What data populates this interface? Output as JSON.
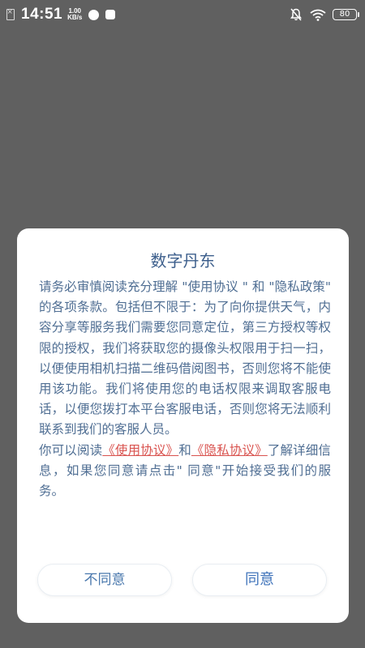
{
  "status_bar": {
    "time": "14:51",
    "net_speed_value": "1.00",
    "net_speed_unit": "KB/s",
    "battery": "80"
  },
  "dialog": {
    "title": "数字丹东",
    "paragraph1": "请务必审慎阅读充分理解 \"使用协议 \" 和 \"隐私政策\" 的各项条款。包括但不限于：为了向你提供天气，内容分享等服务我们需要您同意定位，第三方授权等权限的授权，我们将获取您的摄像头权限用于扫一扫，以便使用相机扫描二维码借阅图书，否则您将不能使用该功能。我们将使用您的电话权限来调取客服电话，以便您拨打本平台客服电话，否则您将无法顺利联系到我们的客服人员。",
    "p2_prefix": "你可以阅读",
    "link_terms": "《使用协议》",
    "p2_and": "和",
    "link_privacy": "《隐私协议》",
    "p2_suffix": "了解详细信息，如果您同意请点击\" 同意\"开始接受我们的服务。",
    "disagree_label": "不同意",
    "agree_label": "同意"
  },
  "colors": {
    "overlay": "#606060",
    "title": "#3d5f8c",
    "body_text": "#4f6e93",
    "link": "#d9534f",
    "button_text": "#4a78ad"
  }
}
